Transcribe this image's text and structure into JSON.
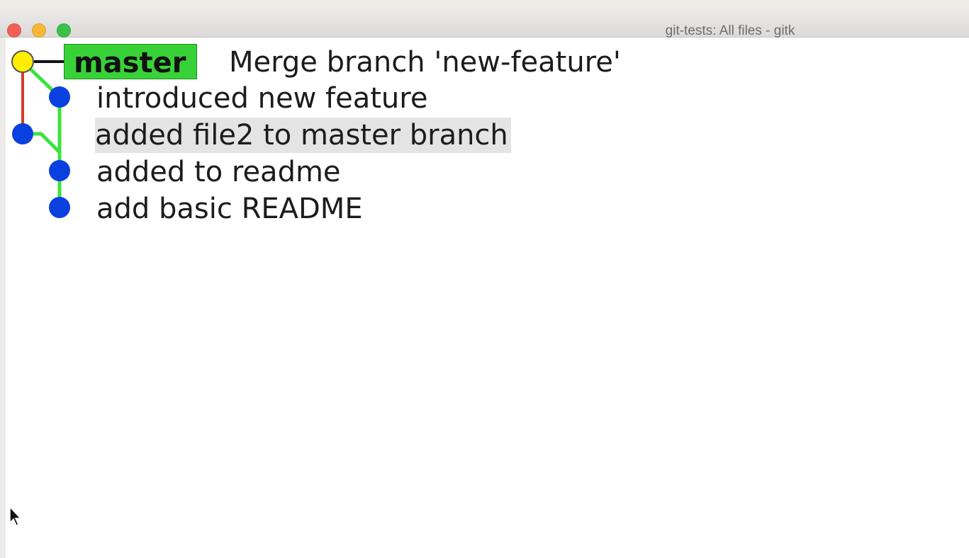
{
  "window": {
    "title": "git-tests: All files - gitk"
  },
  "branch": {
    "label": "master",
    "color": "#38d238"
  },
  "commits": [
    {
      "message": "Merge branch 'new-feature'",
      "node_color": "#ffee00",
      "is_head": true
    },
    {
      "message": "introduced new feature",
      "node_color": "#0a3fe0"
    },
    {
      "message": "added file2 to master branch",
      "node_color": "#0a3fe0",
      "selected": true
    },
    {
      "message": "added to readme",
      "node_color": "#0a3fe0"
    },
    {
      "message": "add basic README",
      "node_color": "#0a3fe0"
    }
  ],
  "graph_colors": {
    "master_line": "#d93a2b",
    "feature_line": "#3ee23e",
    "head_link": "#111111"
  }
}
